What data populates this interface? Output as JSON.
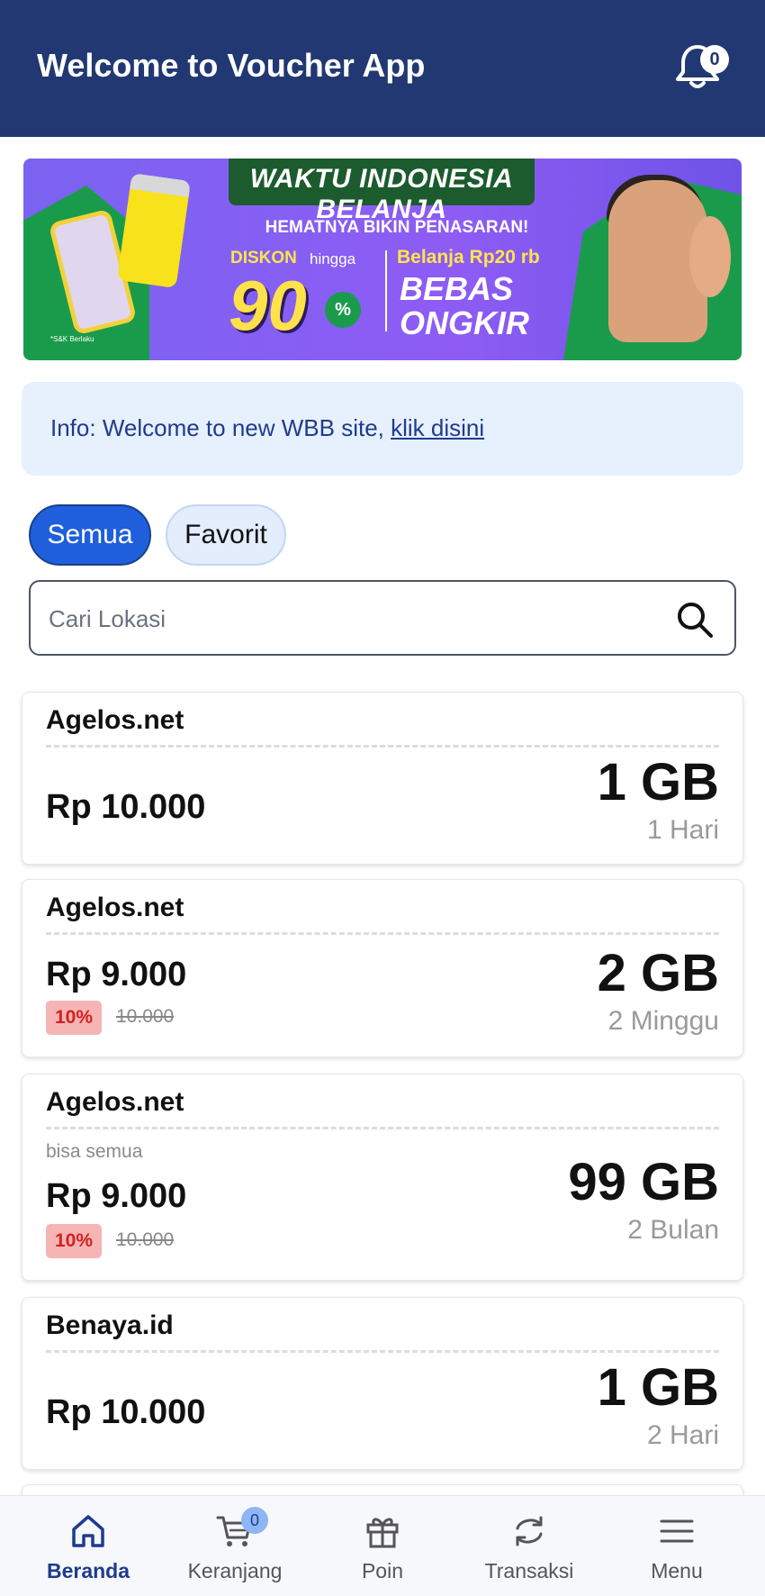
{
  "header": {
    "title": "Welcome to Voucher App",
    "notification_count": "0"
  },
  "banner": {
    "headline": "WAKTU INDONESIA BELANJA",
    "subheadline": "HEMATNYA BIKIN PENASARAN!",
    "diskon_label": "DISKON",
    "hingga_label": "hingga",
    "discount_value": "90",
    "percent_sign": "%",
    "belanja_label": "Belanja Rp20 rb",
    "free_shipping_line1": "BEBAS",
    "free_shipping_line2": "ONGKIR",
    "fine_print": "*S&K Berlaku"
  },
  "info": {
    "prefix": "Info: Welcome to new WBB site, ",
    "link_text": "klik disini"
  },
  "filters": {
    "all_label": "Semua",
    "favorite_label": "Favorit"
  },
  "search": {
    "placeholder": "Cari Lokasi"
  },
  "vouchers": [
    {
      "name": "Agelos.net",
      "price": "Rp 10.000",
      "quota": "1 GB",
      "period": "1 Hari"
    },
    {
      "name": "Agelos.net",
      "price": "Rp 9.000",
      "discount": "10%",
      "original_price": "10.000",
      "quota": "2 GB",
      "period": "2 Minggu"
    },
    {
      "name": "Agelos.net",
      "description": "bisa semua",
      "price": "Rp 9.000",
      "discount": "10%",
      "original_price": "10.000",
      "quota": "99 GB",
      "period": "2 Bulan"
    },
    {
      "name": "Benaya.id",
      "price": "Rp 10.000",
      "quota": "1 GB",
      "period": "2 Hari"
    }
  ],
  "bottom_nav": {
    "items": [
      {
        "label": "Beranda",
        "icon": "home-icon",
        "active": true
      },
      {
        "label": "Keranjang",
        "icon": "cart-icon",
        "badge": "0"
      },
      {
        "label": "Poin",
        "icon": "gift-icon"
      },
      {
        "label": "Transaksi",
        "icon": "refresh-icon"
      },
      {
        "label": "Menu",
        "icon": "menu-icon"
      }
    ]
  },
  "colors": {
    "header_bg": "#213873",
    "accent": "#1f5fdb",
    "info_bg": "#e7f0fd",
    "discount_bg": "#f6b5b5",
    "discount_text": "#d41f1f"
  }
}
